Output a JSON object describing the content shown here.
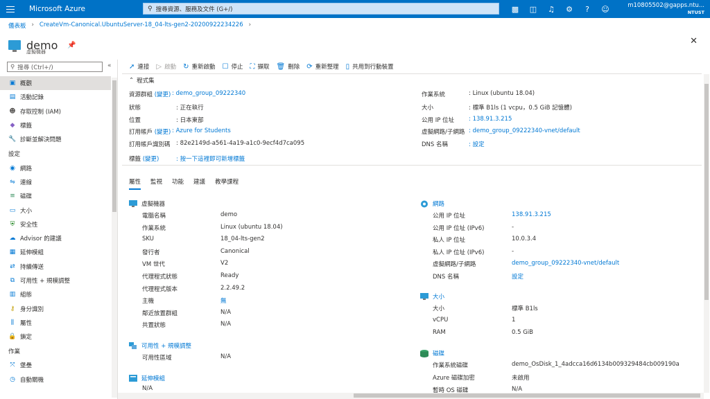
{
  "topbar": {
    "brand": "Microsoft Azure",
    "search_placeholder": "搜尋資源、服務及文件 (G+/)",
    "user_email": "m10805502@gapps.ntu...",
    "user_org": "NTUST",
    "icons": [
      "cloud-shell-icon",
      "directory-filter-icon",
      "notifications-icon",
      "settings-icon",
      "help-icon",
      "feedback-icon"
    ]
  },
  "breadcrumb": [
    "儀表板",
    "CreateVm-Canonical.UbuntuServer-18_04-lts-gen2-20200922234226"
  ],
  "title": {
    "name": "demo",
    "subtitle": "虛擬機器"
  },
  "sidebar": {
    "search_placeholder": "搜尋 (Ctrl+/)",
    "items_top": [
      {
        "label": "概觀",
        "icon": "overview-icon",
        "active": true
      },
      {
        "label": "活動記錄",
        "icon": "activity-log-icon"
      },
      {
        "label": "存取控制 (IAM)",
        "icon": "iam-icon"
      },
      {
        "label": "標籤",
        "icon": "tag-icon"
      },
      {
        "label": "診斷並解決問題",
        "icon": "wrench-icon"
      }
    ],
    "section_settings": "設定",
    "items_settings": [
      {
        "label": "網路",
        "icon": "network-icon"
      },
      {
        "label": "連線",
        "icon": "connect-icon"
      },
      {
        "label": "磁碟",
        "icon": "disk-icon"
      },
      {
        "label": "大小",
        "icon": "size-icon"
      },
      {
        "label": "安全性",
        "icon": "security-icon"
      },
      {
        "label": "Advisor 的建議",
        "icon": "advisor-icon"
      },
      {
        "label": "延伸模組",
        "icon": "extensions-icon"
      },
      {
        "label": "持續傳送",
        "icon": "continuous-delivery-icon"
      },
      {
        "label": "可用性 + 規模調整",
        "icon": "availability-icon"
      },
      {
        "label": "組態",
        "icon": "configuration-icon"
      },
      {
        "label": "身分識別",
        "icon": "identity-icon"
      },
      {
        "label": "屬性",
        "icon": "properties-icon"
      },
      {
        "label": "鎖定",
        "icon": "lock-icon"
      }
    ],
    "section_ops": "作業",
    "items_ops": [
      {
        "label": "堡壘",
        "icon": "bastion-icon"
      },
      {
        "label": "自動關機",
        "icon": "auto-shutdown-icon"
      }
    ]
  },
  "toolbar": [
    {
      "label": "連接",
      "icon": "connect-icon",
      "enabled": true
    },
    {
      "label": "啟動",
      "icon": "play-icon",
      "enabled": false
    },
    {
      "label": "重新啟動",
      "icon": "restart-icon",
      "enabled": true
    },
    {
      "label": "停止",
      "icon": "stop-icon",
      "enabled": true
    },
    {
      "label": "擷取",
      "icon": "capture-icon",
      "enabled": true
    },
    {
      "label": "刪除",
      "icon": "delete-icon",
      "enabled": true
    },
    {
      "label": "重新整理",
      "icon": "refresh-icon",
      "enabled": true
    },
    {
      "label": "共用到行動裝置",
      "icon": "mobile-icon",
      "enabled": true
    }
  ],
  "essentials": {
    "title": "程式集",
    "left": [
      {
        "key": "資源群組",
        "change": "(變更)",
        "value": "demo_group_09222340",
        "link": true
      },
      {
        "key": "狀態",
        "value": "正在執行"
      },
      {
        "key": "位置",
        "value": "日本東部"
      },
      {
        "key": "訂用帳戶",
        "change": "(變更)",
        "value": "Azure for Students",
        "link": true
      },
      {
        "key": "訂用帳戶識別碼",
        "value": "82e2149d-a561-4a19-a1c0-9ecf4d7ca095"
      }
    ],
    "right": [
      {
        "key": "作業系統",
        "value": "Linux (ubuntu 18.04)"
      },
      {
        "key": "大小",
        "value": "標準 B1ls (1 vcpu，0.5 GiB 記憶體)"
      },
      {
        "key": "公用 IP 位址",
        "value": "138.91.3.215",
        "link": true
      },
      {
        "key": "虛擬網路/子網路",
        "value": "demo_group_09222340-vnet/default",
        "link": true
      },
      {
        "key": "DNS 名稱",
        "value": "設定",
        "link": true
      }
    ],
    "tags_key": "標籤",
    "tags_change": "(變更)",
    "tags_value": "按一下這裡即可新增標籤"
  },
  "tabs": [
    "屬性",
    "監視",
    "功能",
    "建議",
    "教學課程"
  ],
  "vm_section": {
    "title": "虛擬機器",
    "rows": [
      {
        "key": "電腦名稱",
        "value": "demo"
      },
      {
        "key": "作業系統",
        "value": "Linux (ubuntu 18.04)"
      },
      {
        "key": "SKU",
        "value": "18_04-lts-gen2"
      },
      {
        "key": "發行者",
        "value": "Canonical"
      },
      {
        "key": "VM 世代",
        "value": "V2"
      },
      {
        "key": "代理程式狀態",
        "value": "Ready"
      },
      {
        "key": "代理程式版本",
        "value": "2.2.49.2"
      },
      {
        "key": "主機",
        "value": "無",
        "link": true
      },
      {
        "key": "鄰近放置群組",
        "value": "N/A"
      },
      {
        "key": "共置狀態",
        "value": "N/A"
      }
    ]
  },
  "avail_section": {
    "title": "可用性 + 規模調整",
    "rows": [
      {
        "key": "可用性區域",
        "value": "N/A"
      }
    ]
  },
  "ext_section": {
    "title": "延伸模組",
    "rows": [
      {
        "key": "N/A"
      }
    ]
  },
  "net_section": {
    "title": "網路",
    "rows": [
      {
        "key": "公用 IP 位址",
        "value": "138.91.3.215",
        "link": true
      },
      {
        "key": "公用 IP 位址 (IPv6)",
        "value": "-"
      },
      {
        "key": "私人 IP 位址",
        "value": "10.0.3.4"
      },
      {
        "key": "私人 IP 位址 (IPv6)",
        "value": "-"
      },
      {
        "key": "虛擬網路/子網路",
        "value": "demo_group_09222340-vnet/default",
        "link": true
      },
      {
        "key": "DNS 名稱",
        "value": "設定",
        "link": true
      }
    ]
  },
  "size_section": {
    "title": "大小",
    "rows": [
      {
        "key": "大小",
        "value": "標準 B1ls"
      },
      {
        "key": "vCPU",
        "value": "1"
      },
      {
        "key": "RAM",
        "value": "0.5 GiB"
      }
    ]
  },
  "disk_section": {
    "title": "磁碟",
    "rows": [
      {
        "key": "作業系統磁碟",
        "value": "demo_OsDisk_1_4adcca16d6134b009329484cb009190a"
      },
      {
        "key": "Azure 磁碟加密",
        "value": "未啟用"
      },
      {
        "key": "暫時 OS 磁碟",
        "value": "N/A"
      }
    ]
  },
  "colors": {
    "accent": "#0078d4",
    "topbar": "#0072c6"
  }
}
